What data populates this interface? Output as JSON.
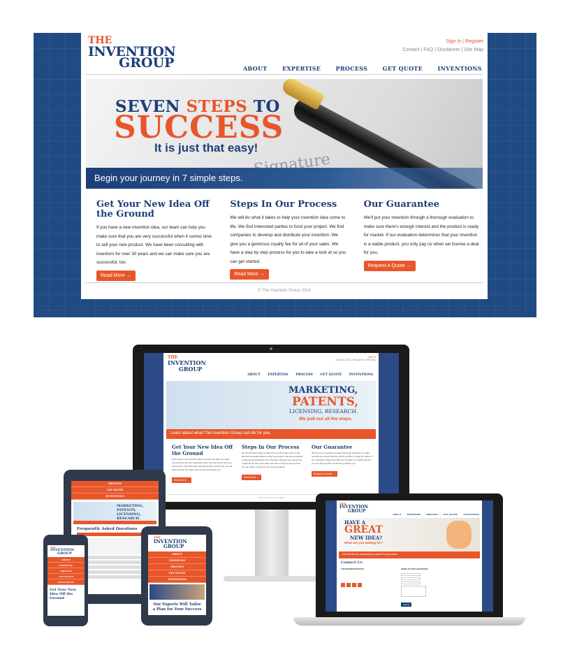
{
  "site": {
    "logo_the": "THE",
    "logo_invention": "INVENTION",
    "logo_group": "GROUP",
    "sign_in": "Sign In",
    "register": "Register",
    "utility_links": "Contact | FAQ | Disclaimer | Site Map",
    "nav": [
      "ABOUT",
      "EXPERTISE",
      "PROCESS",
      "GET QUOTE",
      "INVENTIONS"
    ]
  },
  "hero": {
    "seven": "SEVEN ",
    "steps": "STEPS",
    "to": " TO",
    "success": "SUCCESS",
    "easy": "It is just that easy!",
    "signature": "Signature",
    "banner": "Begin your journey in 7 simple steps."
  },
  "columns": [
    {
      "title": "Get Your New Idea Off the Ground",
      "text": "If you have a new invention idea, our team can help you make sure that you are very successful when it comes time to sell your new product. We have been consulting with inventors for over 30 years and we can make sure you are successful, too.",
      "button": "Read More →"
    },
    {
      "title": "Steps In Our Process",
      "text": "We will do what it takes to help your invention idea come to life. We find interested parties to fund your project. We find companies to develop and distribute your invention. We give you a generous royalty fee for all of your sales. We have a step by step process for you to take a look at so you can get started.",
      "button": "Read More →"
    },
    {
      "title": "Our Guarantee",
      "text": "We'll put your invention through a thorough evaluation to make sure there's enough interest and the product is ready for market. If our evaluation determines that your invention is a viable product, you only pay us when we license a deal for you.",
      "button": "Request A Quote →"
    }
  ],
  "footer": "© The Invention Group 2014",
  "monitor": {
    "hero_1": "MARKETING,",
    "hero_2": "PATENTS,",
    "hero_3": "LICENSING, RESEARCH.",
    "hero_4": "We pull out all the stops.",
    "banner": "Learn about what The Invention Group can do for you."
  },
  "laptop": {
    "hero_1": "HAVE A",
    "hero_2": "GREAT",
    "hero_3": "NEW IDEA?",
    "hero_4": "What are you waiting for?",
    "banner": "Get started by requesting a quote for your idea.",
    "contact": "Contact Us",
    "address_title": "THE INVENTION GROUP",
    "form_title": "SEND US YOUR QUESTIONS.",
    "submit": "Submit"
  },
  "tablet": {
    "menu": [
      "PROCESS",
      "GET QUOTE",
      "INVENTIONS"
    ],
    "faq": "Frequently Asked Questions",
    "hero": "MARKETING, PATENTS, LICENSING, RESEARCH."
  },
  "phone2": {
    "menu": [
      "ABOUT",
      "EXPERTISE",
      "PROCESS",
      "GET QUOTE",
      "INVENTIONS"
    ],
    "headline": "Our Experts Will Tailor a Plan for Your Success"
  },
  "phone1": {
    "menu": [
      "ABOUT",
      "EXPERTISE",
      "PROCESS",
      "GET QUOTE",
      "INVENTIONS"
    ],
    "headline": "Get Your New Idea Off the Ground"
  }
}
